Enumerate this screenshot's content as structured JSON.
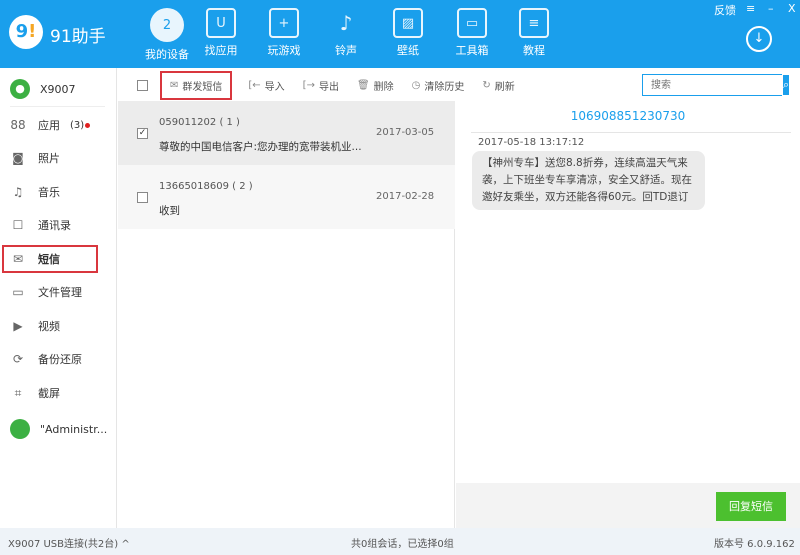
{
  "app": {
    "logo": "9!",
    "name": "91助手"
  },
  "window": {
    "feedback": "反馈",
    "menu": "≡",
    "minimize": "–",
    "close": "X"
  },
  "nav": [
    {
      "label": "我的设备",
      "icon": "2"
    },
    {
      "label": "找应用",
      "icon": "U"
    },
    {
      "label": "玩游戏",
      "icon": "+"
    },
    {
      "label": "铃声",
      "icon": "♪"
    },
    {
      "label": "壁纸",
      "icon": "▨"
    },
    {
      "label": "工具箱",
      "icon": "▭"
    },
    {
      "label": "教程",
      "icon": "≡"
    }
  ],
  "sidebar": {
    "device": "X9007",
    "items": [
      {
        "label": "应用",
        "badge": "(3)"
      },
      {
        "label": "照片"
      },
      {
        "label": "音乐"
      },
      {
        "label": "通讯录"
      },
      {
        "label": "短信"
      },
      {
        "label": "文件管理"
      },
      {
        "label": "视频"
      },
      {
        "label": "备份还原"
      },
      {
        "label": "截屏"
      }
    ],
    "device2": "\"Administr..."
  },
  "toolbar": {
    "group_send": "群发短信",
    "import": "导入",
    "export": "导出",
    "delete": "删除",
    "clear_history": "清除历史",
    "refresh": "刷新",
    "search_placeholder": "搜索"
  },
  "conversations": [
    {
      "number": "059011202 ( 1 )",
      "preview": "尊敬的中国电信客户:您办理的宽带装机业...",
      "date": "2017-03-05",
      "checked": true
    },
    {
      "number": "13665018609 ( 2 )",
      "preview": "收到",
      "date": "2017-02-28",
      "checked": false
    }
  ],
  "detail": {
    "phone": "106908851230730",
    "timestamp": "2017-05-18 13:17:12",
    "message": "【神州专车】送您8.8折券，连续高温天气来袭，上下班坐专车享清凉，安全又舒适。现在邀好友乘坐，双方还能各得60元。回TD退订",
    "reply": "回复短信"
  },
  "status": {
    "device": "X9007  USB连接(共2台) ^",
    "summary": "共0组会话，已选择0组",
    "version": "版本号 6.0.9.162"
  },
  "colors": {
    "brand": "#1a9fec",
    "reply": "#4cc02f",
    "highlight": "#d9363e"
  }
}
